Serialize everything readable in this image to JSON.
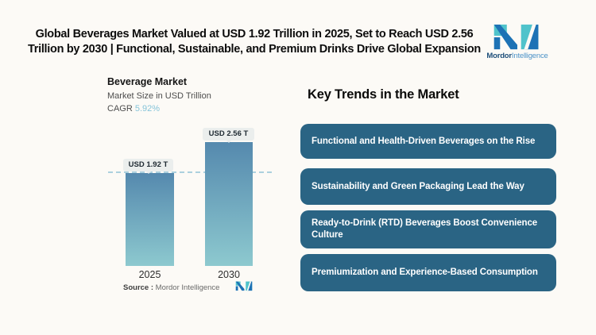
{
  "header": {
    "title": "Global Beverages Market Valued at USD 1.92 Trillion in 2025, Set to Reach USD 2.56 Trillion by 2030 | Functional, Sustainable, and Premium Drinks Drive Global Expansion",
    "logo": {
      "brand_bold": "Mordor",
      "brand_light": "Intelligence",
      "teal": "#4fc3cb",
      "blue": "#1d72b5",
      "brand_bold_color": "#1d4e79",
      "brand_light_color": "#4d93c8"
    }
  },
  "chart": {
    "title": "Beverage Market",
    "subtitle": "Market Size in USD Trillion",
    "cagr_label": "CAGR",
    "cagr_value": "5.92%",
    "cagr_value_color": "#85c4d9"
  },
  "chart_data": {
    "type": "bar",
    "title": "Beverage Market",
    "subtitle": "Market Size in USD Trillion",
    "cagr": "5.92%",
    "categories": [
      "2025",
      "2030"
    ],
    "values": [
      1.92,
      2.56
    ],
    "value_labels": [
      "USD 1.92 T",
      "USD 2.56 T"
    ],
    "unit": "USD Trillion",
    "ylim": [
      0,
      2.56
    ],
    "grid": false,
    "reference_line": {
      "at": 1.92,
      "style": "dashed",
      "color": "#abd0de"
    },
    "bar_gradient_top": "#5589ae",
    "bar_gradient_bottom": "#8dc9cf"
  },
  "source": {
    "label": "Source :",
    "value": "Mordor Intelligence"
  },
  "trends": {
    "heading": "Key Trends in the Market",
    "box_color": "#2a6484",
    "items": [
      {
        "label": "Functional and Health-Driven Beverages on the Rise"
      },
      {
        "label": "Sustainability and Green Packaging Lead the Way"
      },
      {
        "label": "Ready-to-Drink (RTD) Beverages Boost Convenience Culture"
      },
      {
        "label": "Premiumization and Experience-Based Consumption"
      }
    ]
  }
}
